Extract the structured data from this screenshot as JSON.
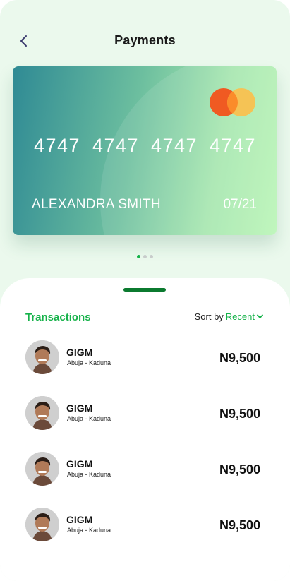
{
  "header": {
    "title": "Payments",
    "back_icon": "chevron-left-icon"
  },
  "card": {
    "number_groups": [
      "4747",
      "4747",
      "4747",
      "4747"
    ],
    "holder": "ALEXANDRA SMITH",
    "expiry": "07/21",
    "brand_icon": "mastercard-logo",
    "colors": {
      "gradient_start": "#2f8a94",
      "gradient_end": "#b9f5b6"
    }
  },
  "carousel": {
    "count": 3,
    "active_index": 0
  },
  "transactions": {
    "title": "Transactions",
    "sort_label": "Sort by",
    "sort_value": "Recent",
    "sort_icon": "chevron-down-icon",
    "items": [
      {
        "name": "GIGM",
        "route": "Abuja - Kaduna",
        "amount": "N9,500"
      },
      {
        "name": "GIGM",
        "route": "Abuja - Kaduna",
        "amount": "N9,500"
      },
      {
        "name": "GIGM",
        "route": "Abuja - Kaduna",
        "amount": "N9,500"
      },
      {
        "name": "GIGM",
        "route": "Abuja - Kaduna",
        "amount": "N9,500"
      }
    ]
  },
  "colors": {
    "accent": "#16b24a",
    "handle": "#0b7a2f",
    "background": "#ebf9ed"
  }
}
